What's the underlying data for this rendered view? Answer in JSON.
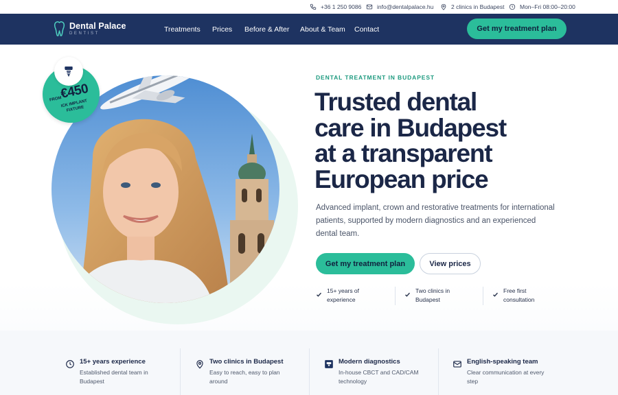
{
  "colors": {
    "navy": "#1e3361",
    "accent": "#2bbd9a",
    "accent_text": "#1d9a7f"
  },
  "topbar": {
    "phone": "+36 1 250 9086",
    "email": "info@dentalpalace.hu",
    "clinics": "2 clinics in Budapest",
    "hours": "Mon–Fri 08:00–20:00",
    "icons": [
      "phone-icon",
      "mail-icon",
      "location-icon",
      "clock-icon"
    ]
  },
  "brand": {
    "name": "Dental Palace",
    "tagline": "DENTIST",
    "icon": "tooth-icon"
  },
  "nav": {
    "links": [
      "Treatments",
      "Prices",
      "Before & After",
      "About & Team",
      "Contact"
    ],
    "cta": "Get my treatment plan"
  },
  "badge": {
    "from": "FROM",
    "price": "€450",
    "label": "ICK IMPLANT FIXTURE",
    "icon": "implant-icon"
  },
  "hero": {
    "eyebrow": "DENTAL TREATMENT IN BUDAPEST",
    "headline": "Trusted dental care in Budapest at a transparent European price",
    "lead": "Advanced implant, crown and restorative treatments for international patients, supported by modern diagnostics and an experienced dental team.",
    "primary_cta": "Get my treatment plan",
    "secondary_cta": "View prices",
    "features": [
      "15+ years of experience",
      "Two clinics in Budapest",
      "Free first consultation"
    ]
  },
  "highlights": [
    {
      "icon": "clock-icon",
      "title": "15+ years experience",
      "desc": "Established dental team in Budapest"
    },
    {
      "icon": "location-icon",
      "title": "Two clinics in Budapest",
      "desc": "Easy to reach, easy to plan around"
    },
    {
      "icon": "diagnostics-icon",
      "title": "Modern diagnostics",
      "desc": "In-house CBCT and CAD/CAM technology"
    },
    {
      "icon": "mail-icon",
      "title": "English-speaking team",
      "desc": "Clear communication at every step"
    }
  ]
}
